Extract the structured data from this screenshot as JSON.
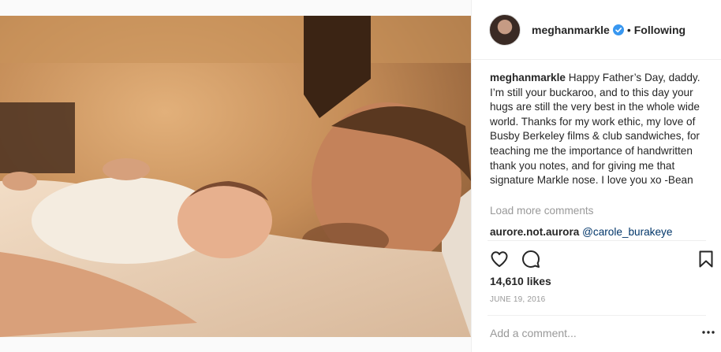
{
  "header": {
    "username": "meghanmarkle",
    "separator": "•",
    "follow_status": "Following"
  },
  "caption": {
    "username": "meghanmarkle",
    "text": "Happy Father’s Day, daddy. I’m still your buckaroo, and to this day your hugs are still the very best in the whole wide world. Thanks for my work ethic, my love of Busby Berkeley films & club sandwiches, for teaching me the importance of handwritten thank you notes, and for giving me that signature Markle nose. I love you xo -Bean"
  },
  "load_more_label": "Load more comments",
  "comments": [
    {
      "username": "aurore.not.aurora",
      "mention": "@carole_burakeye"
    }
  ],
  "likes": "14,610 likes",
  "date": "JUNE 19, 2016",
  "add_comment": {
    "placeholder": "Add a comment..."
  },
  "icons": {
    "like": "heart-icon",
    "comment": "comment-icon",
    "save": "bookmark-icon",
    "more": "more-options-icon",
    "verified": "verified-badge-icon"
  },
  "colors": {
    "text": "#262626",
    "muted": "#999999",
    "verified_blue": "#3897f0",
    "mention": "#003569"
  }
}
